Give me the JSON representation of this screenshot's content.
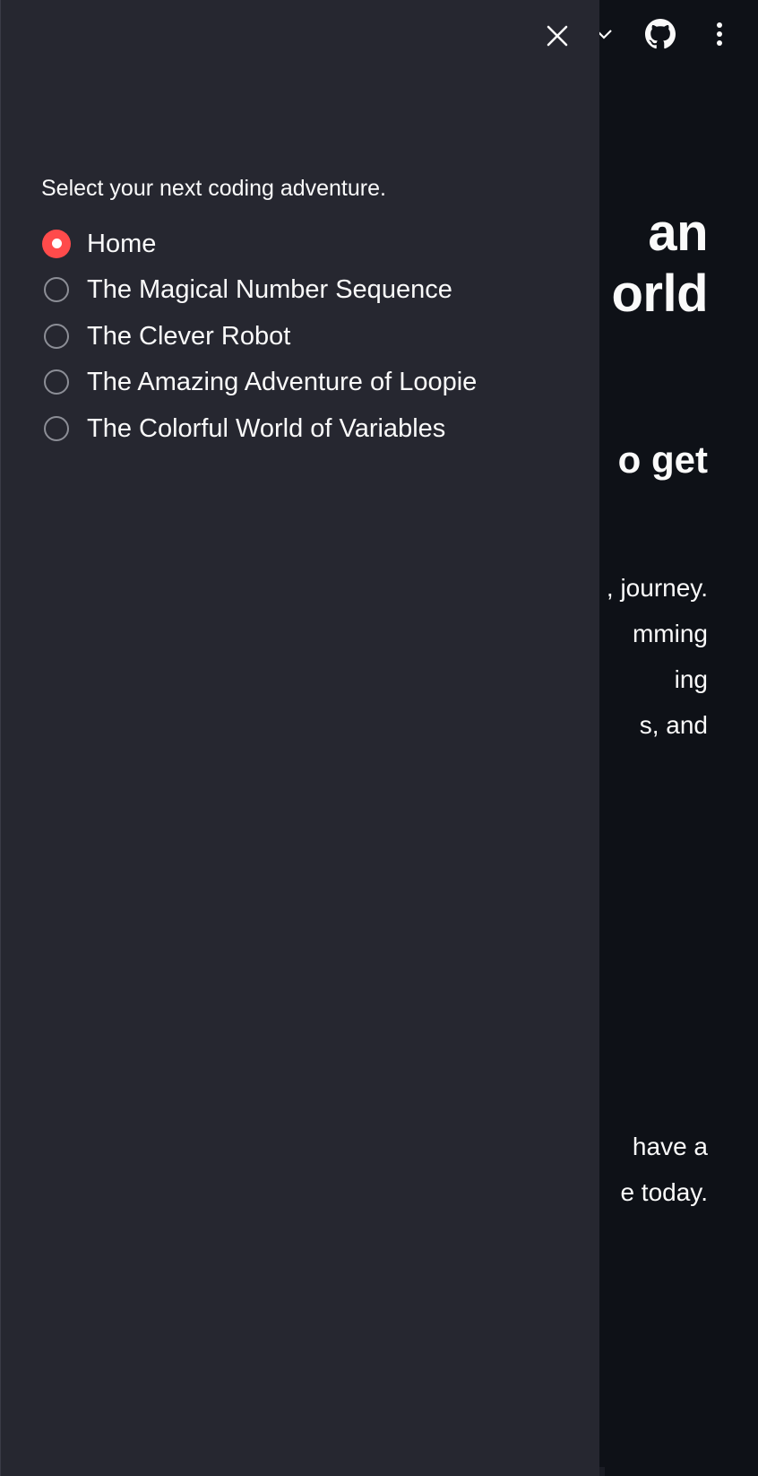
{
  "header": {
    "icons": [
      "chevron-down-icon",
      "github-icon",
      "kebab-menu-icon"
    ]
  },
  "main": {
    "title_line1": "an",
    "title_line2": "orld",
    "subtitle": "o get",
    "paragraph1": [
      ", journey.",
      "mming",
      "ing",
      "s, and"
    ],
    "paragraph2": [
      "have a",
      "e today."
    ]
  },
  "sidebar": {
    "close_icon": "close-icon",
    "nav_label": "Select your next coding adventure.",
    "options": [
      {
        "label": "Home",
        "selected": true
      },
      {
        "label": "The Magical Number Sequence",
        "selected": false
      },
      {
        "label": "The Clever Robot",
        "selected": false
      },
      {
        "label": "The Amazing Adventure of Loopie",
        "selected": false
      },
      {
        "label": "The Colorful World of Variables",
        "selected": false
      }
    ]
  },
  "colors": {
    "sidebar_bg": "#262730",
    "main_bg": "#0e1117",
    "accent": "#ff4b4b",
    "text": "#fafafa"
  }
}
